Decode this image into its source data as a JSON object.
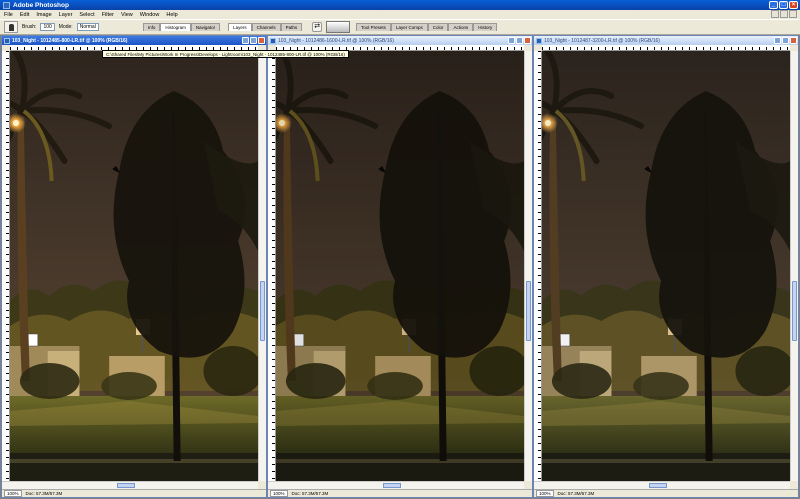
{
  "app": {
    "title": "Adobe Photoshop",
    "colors": {
      "titlebar": "#0a5fd8",
      "chrome": "#ece9d8",
      "canvas_sky": "#3a2c22",
      "lamp": "#ffb347"
    }
  },
  "menu": [
    "File",
    "Edit",
    "Image",
    "Layer",
    "Select",
    "Filter",
    "View",
    "Window",
    "Help"
  ],
  "options": {
    "brush_label": "Brush:",
    "brush_size": "100",
    "mode_label": "Mode:",
    "mode_value": "Normal",
    "well_tabs_left": [
      "Info",
      "Histogram",
      "Navigator"
    ],
    "well_tabs_right": [
      "Layers",
      "Channels",
      "Paths"
    ],
    "well_tabs_far": [
      "Tool Presets",
      "Layer Comps",
      "Color",
      "Actions",
      "History"
    ]
  },
  "documents": [
    {
      "title": "103_Night - 1012485-800-LR.tif @ 100% (RGB/16)",
      "zoom": "100%",
      "doc_size": "Doc: 57.3M/57.3M",
      "active": true
    },
    {
      "title": "103_Night - 1012486-1600-LR.tif @ 100% (RGB/16)",
      "zoom": "100%",
      "doc_size": "Doc: 57.3M/57.3M",
      "active": false
    },
    {
      "title": "103_Night - 1012487-3200-LR.tif @ 100% (RGB/16)",
      "zoom": "100%",
      "doc_size": "Doc: 57.3M/57.3M",
      "active": false
    }
  ],
  "tooltip": "C:\\Shared Files\\My Pictures\\Work In Progress\\Develops - Lightroom\\103_Night - 1012485-800-LR.tif @ 100% (RGB/16)"
}
